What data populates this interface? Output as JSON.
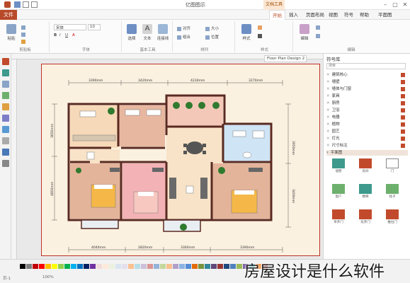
{
  "window": {
    "title": "亿图图示",
    "context_tab": "文档工具"
  },
  "tabs": {
    "file": "文件",
    "items": [
      "开始",
      "插入",
      "页面布局",
      "视图",
      "符号",
      "帮助",
      "平面图"
    ],
    "active_index": 0
  },
  "ribbon": {
    "groups": [
      {
        "label": "剪贴板"
      },
      {
        "label": "字体"
      },
      {
        "label": "基本工具"
      },
      {
        "label": "排列"
      },
      {
        "label": "样式"
      },
      {
        "label": "编辑"
      }
    ],
    "buttons": [
      "粘贴",
      "文本",
      "选择",
      "连接线",
      "样式",
      "编辑",
      "对齐",
      "组合",
      "大小",
      "位置"
    ],
    "font_name": "宋体",
    "font_size": "10"
  },
  "document_tab": "Floor Plan Design 2",
  "library": {
    "title": "符号库",
    "search_placeholder": "搜索",
    "items": [
      "建筑核心",
      "墙壁",
      "墙体与门窗",
      "家具",
      "厨房",
      "卫浴",
      "电器",
      "植物",
      "园艺",
      "灯光",
      "尺寸标注",
      "平面图"
    ],
    "shapes": [
      {
        "label": "墙壁"
      },
      {
        "label": "房间"
      },
      {
        "label": "门"
      },
      {
        "label": "窗户"
      },
      {
        "label": "楼梯"
      },
      {
        "label": "柱子"
      },
      {
        "label": "单开门"
      },
      {
        "label": "双开门"
      },
      {
        "label": "推拉门"
      }
    ]
  },
  "dimensions": {
    "top": [
      "3390mm",
      "3420mm",
      "4230mm",
      "3270mm"
    ],
    "bottom": [
      "4040mm",
      "2820mm",
      "3360mm",
      "3390mm"
    ],
    "left": [
      "3650mm",
      "4800mm"
    ],
    "right": [
      "3950mm",
      "3400mm"
    ]
  },
  "status": {
    "page": "页-1",
    "zoom": "100%",
    "watermark": "房屋设计是什么软件"
  },
  "colors": {
    "accent": "#b84a2a",
    "wall": "#5a2a22",
    "sheet_border": "#c0302a",
    "room_floor": "#f6d9b8",
    "tile": "#e8b7a0",
    "bedroom_pink": "#f3b2b5",
    "bath_blue": "#cfe4f5"
  },
  "palette": [
    "#000000",
    "#7f7f7f",
    "#c00000",
    "#ff0000",
    "#ffc000",
    "#ffff00",
    "#92d050",
    "#00b050",
    "#00b0f0",
    "#0070c0",
    "#002060",
    "#7030a0",
    "#f2dcdb",
    "#fde9d9",
    "#ebf1de",
    "#dbe5f1",
    "#e4dfec",
    "#fac090",
    "#b7dee8",
    "#ccc0da",
    "#d99694",
    "#95b3d7",
    "#c4d79b",
    "#fabf8f",
    "#b1a0c7",
    "#8db4e2",
    "#538dd5",
    "#e26b0a",
    "#76933c",
    "#31869b",
    "#60497a",
    "#963634",
    "#1f497d",
    "#4f81bd",
    "#9bbb59",
    "#8064a2",
    "#4bacc6",
    "#f79646",
    "#c0504d"
  ]
}
